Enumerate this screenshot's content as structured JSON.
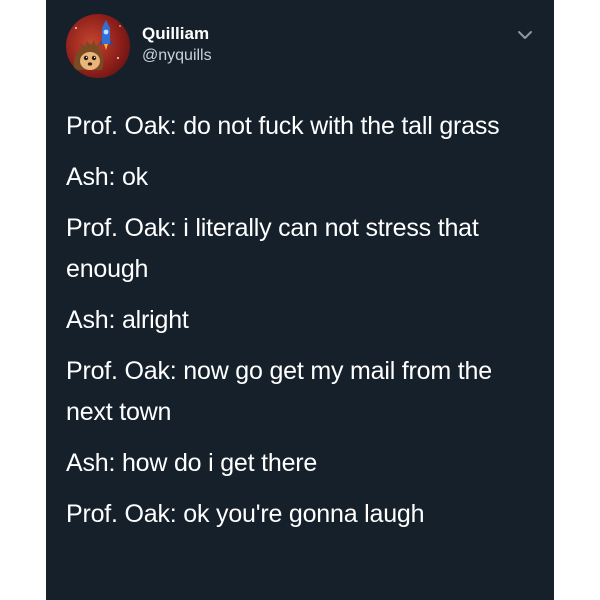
{
  "tweet": {
    "display_name": "Quilliam",
    "handle": "@nyquills",
    "avatar_icon": "hedgehog-rocket-avatar",
    "menu_icon": "chevron-down-icon",
    "background_color": "#15202b",
    "lines": [
      "Prof. Oak: do not fuck with the tall grass",
      "Ash: ok",
      "Prof. Oak: i literally can not stress that enough",
      "Ash: alright",
      "Prof. Oak: now go get my mail from the next town",
      "Ash: how do i get there",
      "Prof. Oak: ok you're gonna laugh"
    ]
  }
}
